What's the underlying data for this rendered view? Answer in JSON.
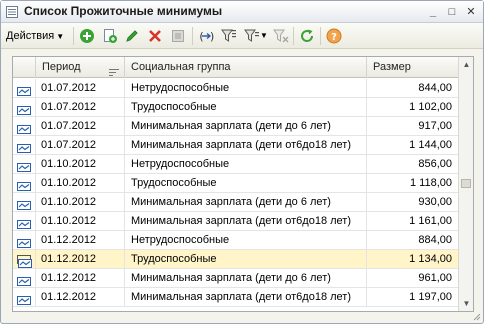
{
  "window": {
    "title": "Список Прожиточные минимумы",
    "icon": "document-list-icon",
    "controls": [
      "minimize",
      "maximize",
      "close"
    ]
  },
  "toolbar": {
    "actions_label": "Действия",
    "icons": [
      "add-icon",
      "copy-icon",
      "edit-icon",
      "delete-icon",
      "disabled-icon",
      "set-interval-icon",
      "filter-icon",
      "filter-options-icon",
      "clear-filter-icon",
      "refresh-icon",
      "help-icon"
    ]
  },
  "table": {
    "columns": [
      "Период",
      "Социальная группа",
      "Размер"
    ],
    "selected_row_index": 9,
    "rows": [
      {
        "period": "01.07.2012",
        "group": "Нетрудоспособные",
        "size": "844,00"
      },
      {
        "period": "01.07.2012",
        "group": "Трудоспособные",
        "size": "1 102,00"
      },
      {
        "period": "01.07.2012",
        "group": "Минимальная зарплата (дети до 6 лет)",
        "size": "917,00"
      },
      {
        "period": "01.07.2012",
        "group": "Минимальная зарплата (дети от6до18 лет)",
        "size": "1 144,00"
      },
      {
        "period": "01.10.2012",
        "group": "Нетрудоспособные",
        "size": "856,00"
      },
      {
        "period": "01.10.2012",
        "group": "Трудоспособные",
        "size": "1 118,00"
      },
      {
        "period": "01.10.2012",
        "group": "Минимальная зарплата (дети до 6 лет)",
        "size": "930,00"
      },
      {
        "period": "01.10.2012",
        "group": "Минимальная зарплата (дети от6до18 лет)",
        "size": "1 161,00"
      },
      {
        "period": "01.12.2012",
        "group": "Нетрудоспособные",
        "size": "884,00"
      },
      {
        "period": "01.12.2012",
        "group": "Трудоспособные",
        "size": "1 134,00"
      },
      {
        "period": "01.12.2012",
        "group": "Минимальная зарплата (дети до 6 лет)",
        "size": "961,00"
      },
      {
        "period": "01.12.2012",
        "group": "Минимальная зарплата (дети от6до18 лет)",
        "size": "1 197,00"
      }
    ]
  },
  "colors": {
    "selected_row": "#fff5c8",
    "row_icon": "#2a5fb0",
    "add_green": "#3aa335",
    "delete_red": "#d8352a"
  }
}
